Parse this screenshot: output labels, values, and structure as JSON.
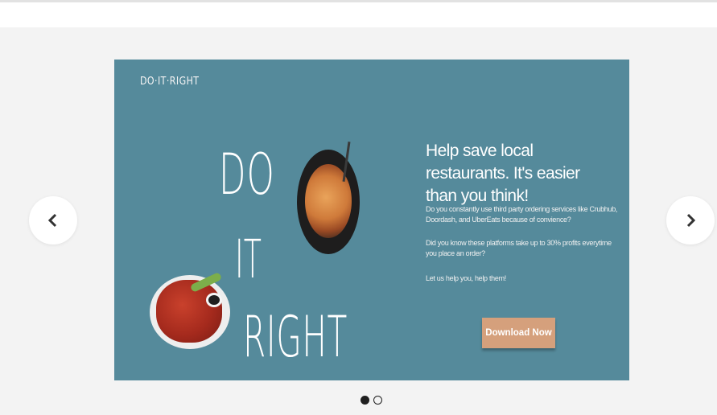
{
  "slide": {
    "brand": "DO·IT·RIGHT",
    "big_text": {
      "line1": "DO",
      "line2": "IT",
      "line3": "RIGHT"
    },
    "headline": "Help save local restaurants. It's easier than you think!",
    "paragraph1": "Do you constantly use third party ordering services like Crubhub, Doordash, and UberEats because of convience?",
    "paragraph2": "Did you know these platforms take up to 30% profits everytime you place an order?",
    "paragraph3": "Let us help you, help them!",
    "cta_label": "Download Now",
    "background_color": "#558a9b",
    "cta_color": "#d5a07c"
  },
  "carousel": {
    "prev_icon": "chevron-left-icon",
    "next_icon": "chevron-right-icon",
    "dots": [
      {
        "active": true
      },
      {
        "active": false
      }
    ]
  }
}
